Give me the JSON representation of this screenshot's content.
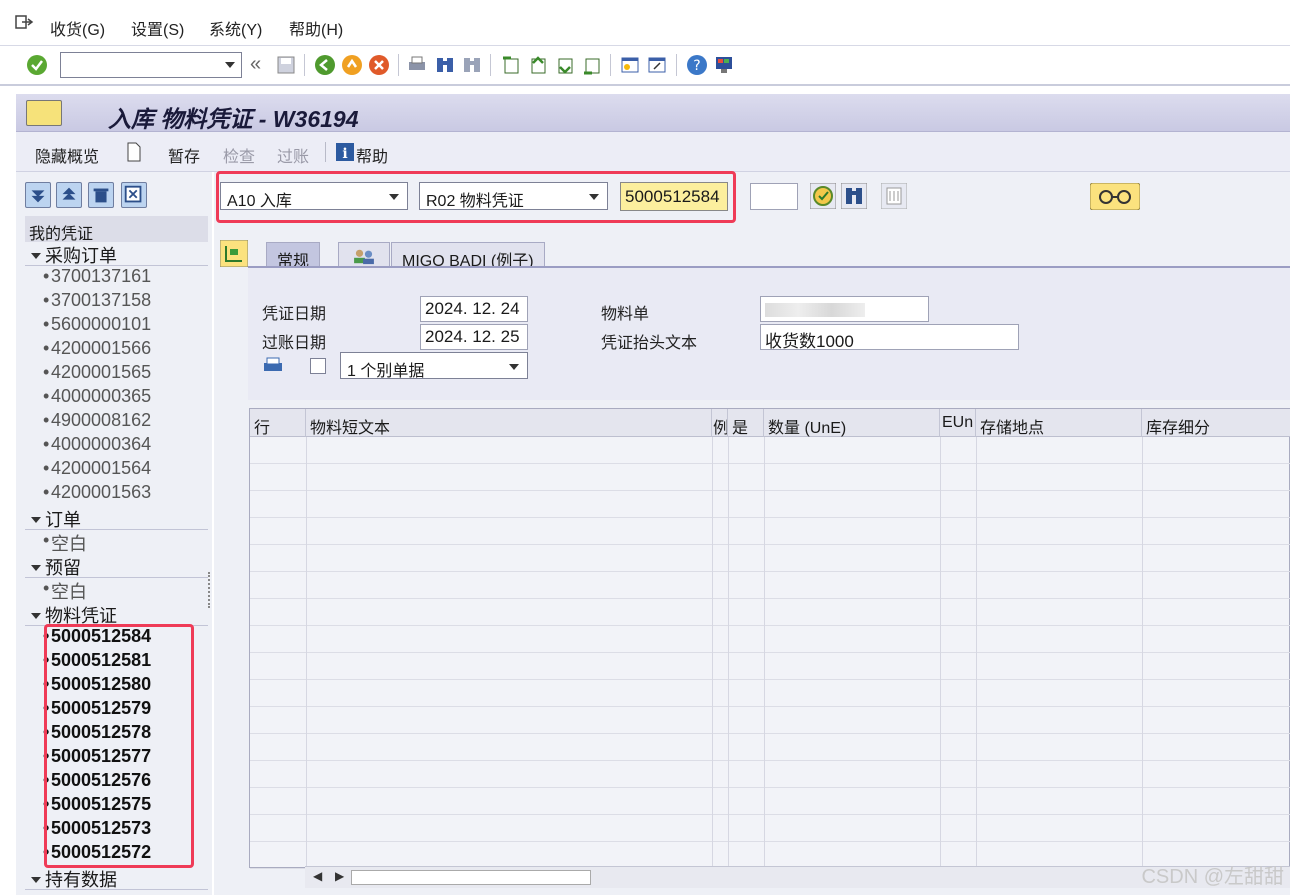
{
  "menubar": {
    "items": [
      "收货(G)",
      "设置(S)",
      "系统(Y)",
      "帮助(H)"
    ]
  },
  "toolbar": {
    "command_value": "",
    "icons": [
      "check-icon",
      "save-icon",
      "back-icon",
      "exit-icon",
      "cancel-icon",
      "print-icon",
      "find-icon",
      "find-next-icon",
      "first-page-icon",
      "prev-page-icon",
      "next-page-icon",
      "last-page-icon",
      "new-session-icon",
      "shortcut-icon",
      "help-icon",
      "layout-icon"
    ]
  },
  "title": "入库 物料凭证 - W36194",
  "app_toolbar": {
    "hide_overview": "隐藏概览",
    "hold": "暂存",
    "check": "检查",
    "post": "过账",
    "help": "帮助"
  },
  "left_panel": {
    "header": "我的凭证",
    "sections": [
      {
        "label": "采购订单",
        "items": [
          "3700137161",
          "3700137158",
          "5600000101",
          "4200001566",
          "4200001565",
          "4000000365",
          "4900008162",
          "4000000364",
          "4200001564",
          "4200001563"
        ]
      },
      {
        "label": "订单",
        "items": [
          "空白"
        ]
      },
      {
        "label": "预留",
        "items": [
          "空白"
        ]
      },
      {
        "label": "物料凭证",
        "items": [
          "5000512584",
          "5000512581",
          "5000512580",
          "5000512579",
          "5000512578",
          "5000512577",
          "5000512576",
          "5000512575",
          "5000512573",
          "5000512572"
        ]
      },
      {
        "label": "持有数据",
        "items": []
      }
    ]
  },
  "main": {
    "action": "A10 入库",
    "reference": "R02 物料凭证",
    "document_number": "5000512584",
    "year_value": "",
    "tabs": [
      "常规",
      "MIGO BADI (例子)"
    ],
    "general": {
      "doc_date_label": "凭证日期",
      "doc_date": "2024. 12. 24",
      "posting_date_label": "过账日期",
      "posting_date": "2024. 12. 25",
      "material_slip_label": "物料单",
      "material_slip": "",
      "header_text_label": "凭证抬头文本",
      "header_text": "收货数1000",
      "print_option": "1 个别单据"
    },
    "table": {
      "columns": [
        "行",
        "物料短文本",
        "例",
        "是",
        "数量 (UnE)",
        "EUn",
        "存储地点",
        "库存细分"
      ]
    }
  },
  "watermark": "CSDN @左甜甜"
}
